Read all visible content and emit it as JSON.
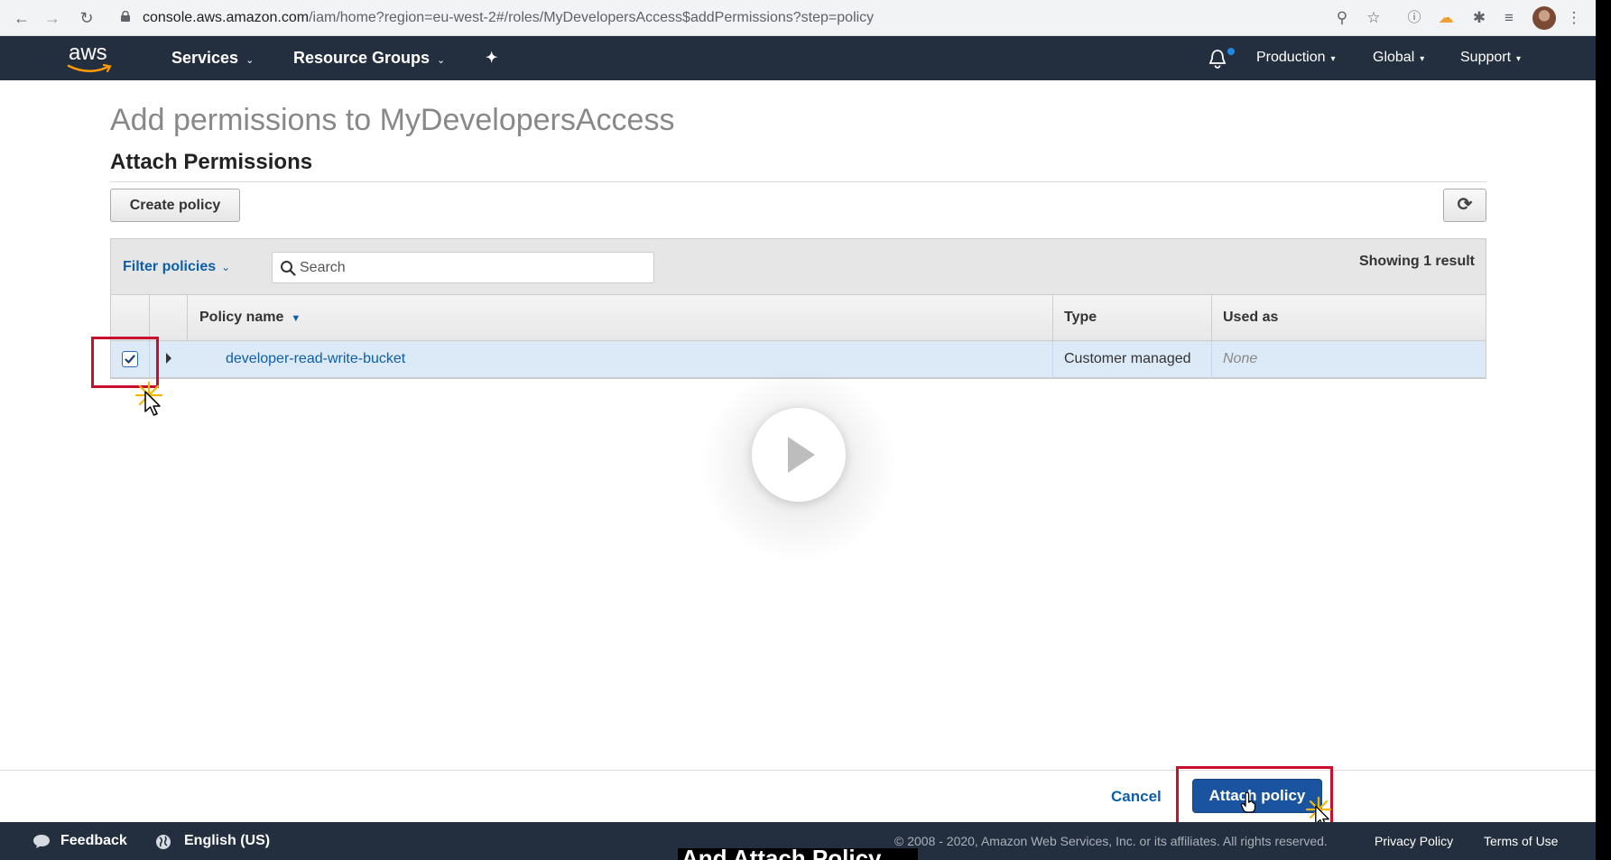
{
  "browser": {
    "url_domain": "console.aws.amazon.com",
    "url_path": "/iam/home?region=eu-west-2#/roles/MyDevelopersAccess$addPermissions?step=policy"
  },
  "aws_nav": {
    "logo_text": "aws",
    "services": "Services",
    "resource_groups": "Resource Groups",
    "account": "Production",
    "region": "Global",
    "support": "Support"
  },
  "page": {
    "title": "Add permissions to MyDevelopersAccess",
    "section_title": "Attach Permissions",
    "create_policy": "Create policy"
  },
  "filter": {
    "label": "Filter policies",
    "search_placeholder": "Search",
    "result_count": "Showing 1 result"
  },
  "table": {
    "columns": [
      "Policy name",
      "Type",
      "Used as"
    ],
    "rows": [
      {
        "name": "developer-read-write-bucket",
        "type": "Customer managed",
        "used_as": "None",
        "checked": true
      }
    ]
  },
  "actions": {
    "cancel": "Cancel",
    "attach": "Attach policy"
  },
  "footer": {
    "feedback": "Feedback",
    "language": "English (US)",
    "copyright": "© 2008 - 2020, Amazon Web Services, Inc. or its affiliates. All rights reserved.",
    "privacy": "Privacy Policy",
    "terms": "Terms of Use"
  },
  "caption": {
    "text": "And Attach Policy"
  },
  "colors": {
    "aws_nav_bg": "#232f3e",
    "link_blue": "#0e5fa8",
    "primary_button": "#1a54a1",
    "selected_row": "#dce9f7",
    "highlight_red": "#c8102e"
  },
  "icons": [
    "back-arrow-icon",
    "forward-arrow-icon",
    "reload-icon",
    "lock-icon",
    "zoom-icon",
    "star-icon",
    "info-icon",
    "cloud-icon",
    "puzzle-icon",
    "media-icon",
    "menu-dots-icon",
    "pin-icon",
    "bell-icon",
    "search-icon",
    "refresh-icon",
    "play-icon",
    "chat-bubble-icon",
    "globe-icon",
    "mouse-cursor-icon"
  ]
}
